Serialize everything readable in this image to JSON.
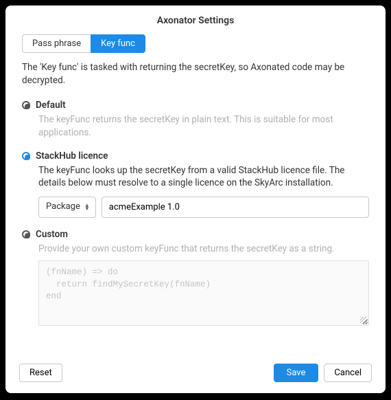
{
  "title": "Axonator Settings",
  "tabs": {
    "pass_phrase": "Pass phrase",
    "key_func": "Key func",
    "active": "key_func"
  },
  "description": "The 'Key func' is tasked with returning the secretKey, so Axonated code may be decrypted.",
  "options": {
    "default": {
      "label": "Default",
      "desc": "The keyFunc returns the secretKey in plain text. This is suitable for most applications."
    },
    "stackhub": {
      "label": "StackHub licence",
      "desc": "The keyFunc looks up the secretKey from a valid StackHub licence file. The details below must resolve to a single licence on the SkyArc installation.",
      "select_label": "Package",
      "input_value": "acmeExample 1.0"
    },
    "custom": {
      "label": "Custom",
      "desc": "Provide your own custom keyFunc that returns the secretKey as a string.",
      "code": "(fnName) => do\n  return findMySecretKey(fnName)\nend"
    },
    "selected": "stackhub"
  },
  "footer": {
    "reset": "Reset",
    "save": "Save",
    "cancel": "Cancel"
  }
}
